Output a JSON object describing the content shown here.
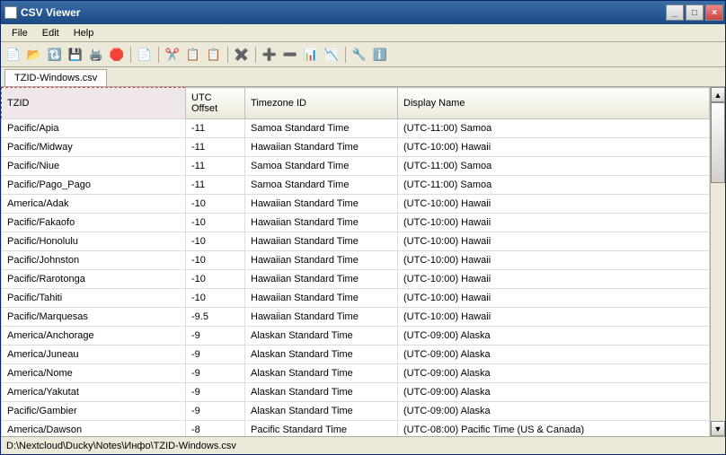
{
  "titlebar": {
    "title": "CSV Viewer"
  },
  "menu": {
    "file": "File",
    "edit": "Edit",
    "help": "Help"
  },
  "toolbar_icons": {
    "new": "📄",
    "open": "📂",
    "refresh": "🔃",
    "save": "💾",
    "print": "🖨️",
    "stop": "🛑",
    "page": "📄",
    "cut": "✂️",
    "copy": "📋",
    "paste": "📋",
    "delete": "✖️",
    "ins_row": "➕",
    "del_row": "➖",
    "ins_col": "📊",
    "del_col": "📉",
    "tool": "🔧",
    "info": "ℹ️"
  },
  "tab": {
    "label": "TZID-Windows.csv"
  },
  "columns": [
    "TZID",
    "UTC Offset",
    "Timezone ID",
    "Display Name"
  ],
  "rows": [
    [
      "Pacific/Apia",
      "-11",
      "Samoa Standard Time",
      "(UTC-11:00) Samoa"
    ],
    [
      "Pacific/Midway",
      "-11",
      "Hawaiian Standard Time",
      "(UTC-10:00) Hawaii"
    ],
    [
      "Pacific/Niue",
      "-11",
      "Samoa Standard Time",
      "(UTC-11:00) Samoa"
    ],
    [
      "Pacific/Pago_Pago",
      "-11",
      "Samoa Standard Time",
      "(UTC-11:00) Samoa"
    ],
    [
      "America/Adak",
      "-10",
      "Hawaiian Standard Time",
      "(UTC-10:00) Hawaii"
    ],
    [
      "Pacific/Fakaofo",
      "-10",
      "Hawaiian Standard Time",
      "(UTC-10:00) Hawaii"
    ],
    [
      "Pacific/Honolulu",
      "-10",
      "Hawaiian Standard Time",
      "(UTC-10:00) Hawaii"
    ],
    [
      "Pacific/Johnston",
      "-10",
      "Hawaiian Standard Time",
      "(UTC-10:00) Hawaii"
    ],
    [
      "Pacific/Rarotonga",
      "-10",
      "Hawaiian Standard Time",
      "(UTC-10:00) Hawaii"
    ],
    [
      "Pacific/Tahiti",
      "-10",
      "Hawaiian Standard Time",
      "(UTC-10:00) Hawaii"
    ],
    [
      "Pacific/Marquesas",
      "-9.5",
      "Hawaiian Standard Time",
      "(UTC-10:00) Hawaii"
    ],
    [
      "America/Anchorage",
      "-9",
      "Alaskan Standard Time",
      "(UTC-09:00) Alaska"
    ],
    [
      "America/Juneau",
      "-9",
      "Alaskan Standard Time",
      "(UTC-09:00) Alaska"
    ],
    [
      "America/Nome",
      "-9",
      "Alaskan Standard Time",
      "(UTC-09:00) Alaska"
    ],
    [
      "America/Yakutat",
      "-9",
      "Alaskan Standard Time",
      "(UTC-09:00) Alaska"
    ],
    [
      "Pacific/Gambier",
      "-9",
      "Alaskan Standard Time",
      "(UTC-09:00) Alaska"
    ],
    [
      "America/Dawson",
      "-8",
      "Pacific Standard Time",
      "(UTC-08:00) Pacific Time (US & Canada)"
    ]
  ],
  "status": {
    "path": "D:\\Nextcloud\\Ducky\\Notes\\Инфо\\TZID-Windows.csv"
  },
  "scroll": {
    "up": "▲",
    "down": "▼"
  }
}
